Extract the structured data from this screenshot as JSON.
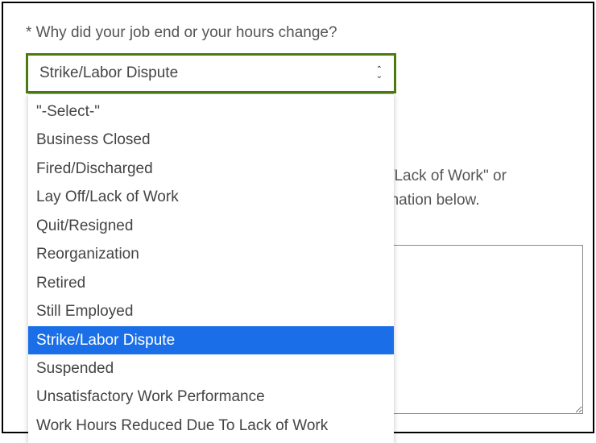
{
  "question": {
    "label": "* Why did your job end or your hours change?"
  },
  "select": {
    "selected_value": "Strike/Labor Dispute",
    "options": [
      "\"-Select-\"",
      "Business Closed",
      "Fired/Discharged",
      "Lay Off/Lack of Work",
      "Quit/Resigned",
      "Reorganization",
      "Retired",
      "Still Employed",
      "Strike/Labor Dispute",
      "Suspended",
      "Unsatisfactory Work Performance",
      "Work Hours Reduced Due To Lack of Work"
    ],
    "selected_index": 8
  },
  "hint": {
    "line1_suffix": "ff/Lack of Work\" or",
    "line2_suffix": "anation below."
  },
  "textarea": {
    "value": ""
  }
}
